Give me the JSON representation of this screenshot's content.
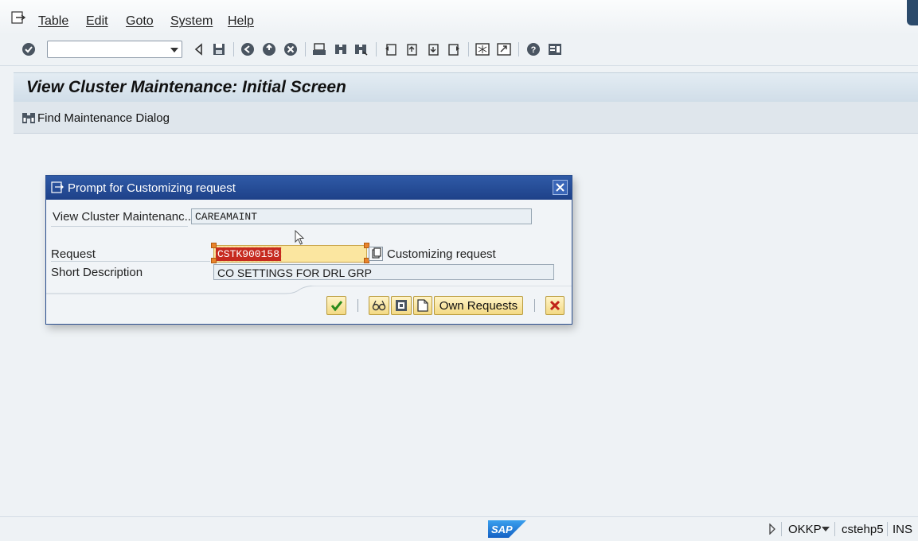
{
  "menu": {
    "items": [
      {
        "label": "Table"
      },
      {
        "label": "Edit"
      },
      {
        "label": "Goto"
      },
      {
        "label": "System"
      },
      {
        "label": "Help"
      }
    ]
  },
  "toolbar": {
    "command_field_value": ""
  },
  "screen": {
    "title": "View Cluster Maintenance: Initial Screen",
    "find_dialog_button": "Find Maintenance Dialog"
  },
  "dialog": {
    "title": "Prompt for Customizing request",
    "view_cluster_label": "View Cluster Maintenanc..",
    "view_cluster_value": "CAREAMAINT",
    "request_label": "Request",
    "request_value": "CSTK900158",
    "request_type_label": "Customizing request",
    "short_desc_label": "Short Description",
    "short_desc_value": "CO SETTINGS FOR DRL GRP",
    "own_requests_button": "Own Requests"
  },
  "status": {
    "transaction": "OKKP",
    "server": "cstehp5",
    "mode": "INS"
  },
  "colors": {
    "dialog_header": "#2b4f8f",
    "selection": "#c62a1f",
    "request_field": "#fbe6a0"
  }
}
